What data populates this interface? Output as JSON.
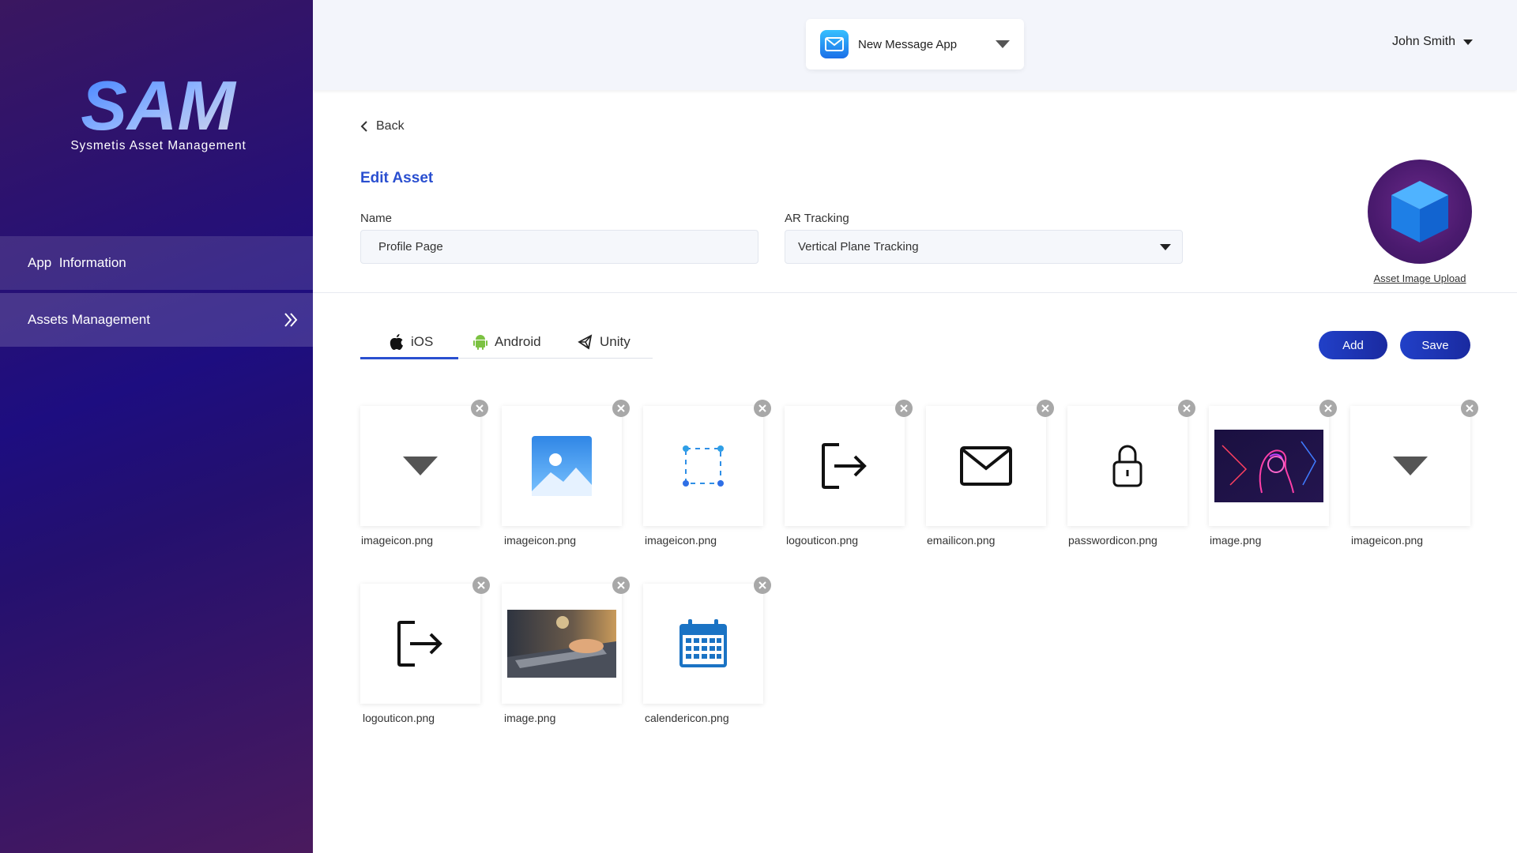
{
  "sidebar": {
    "logo_text": "SAM",
    "logo_subtitle": "Sysmetis Asset Management",
    "items": [
      {
        "label": "App  Information"
      },
      {
        "label": "Assets Management"
      }
    ]
  },
  "header": {
    "app_name": "New Message App",
    "user_name": "John Smith"
  },
  "page": {
    "back_label": "Back",
    "title": "Edit Asset",
    "name_label": "Name",
    "name_value": "Profile Page",
    "ar_label": "AR Tracking",
    "ar_value": "Vertical Plane Tracking",
    "asset_upload_label": "Asset Image Upload"
  },
  "tabs": [
    {
      "label": "iOS",
      "icon": "apple-icon",
      "active": true
    },
    {
      "label": "Android",
      "icon": "android-icon",
      "active": false
    },
    {
      "label": "Unity",
      "icon": "unity-icon",
      "active": false
    }
  ],
  "actions": {
    "add_label": "Add",
    "save_label": "Save"
  },
  "assets": [
    {
      "filename": "imageicon.png",
      "icon": "caret-down-icon"
    },
    {
      "filename": "imageicon.png",
      "icon": "picture-icon"
    },
    {
      "filename": "imageicon.png",
      "icon": "selection-box-icon"
    },
    {
      "filename": "logouticon.png",
      "icon": "logout-icon"
    },
    {
      "filename": "emailicon.png",
      "icon": "email-icon"
    },
    {
      "filename": "passwordicon.png",
      "icon": "lock-icon"
    },
    {
      "filename": "image.png",
      "icon": "neon-figure-image"
    },
    {
      "filename": "imageicon.png",
      "icon": "caret-down-icon"
    },
    {
      "filename": "logouticon.png",
      "icon": "logout-icon"
    },
    {
      "filename": "image.png",
      "icon": "laptop-photo-image"
    },
    {
      "filename": "calendericon.png",
      "icon": "calendar-icon"
    }
  ],
  "colors": {
    "accent": "#2a4fd0",
    "sidebar_dark": "#1d0d80",
    "button": "#2140c8"
  }
}
